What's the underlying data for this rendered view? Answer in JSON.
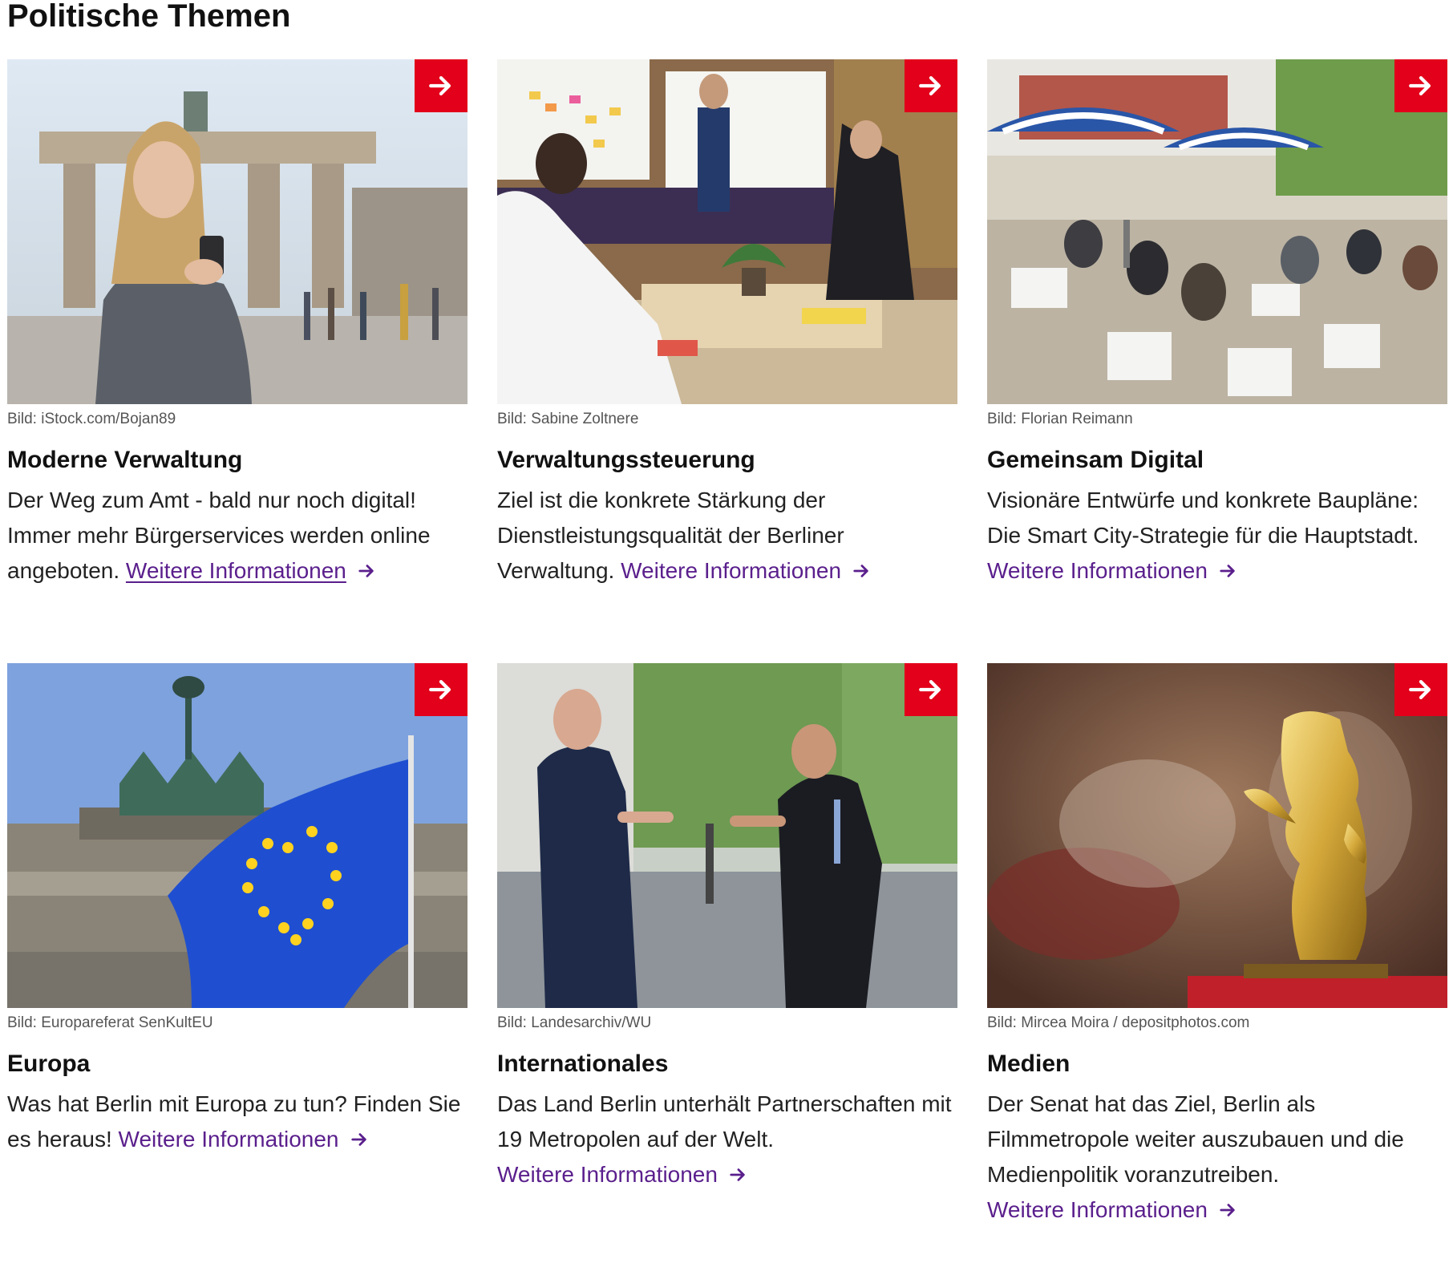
{
  "section": {
    "title": "Politische Themen"
  },
  "colors": {
    "accent_red": "#e2001a",
    "link_purple": "#5a1f8c",
    "caption_gray": "#555555"
  },
  "cards": [
    {
      "caption": "Bild: iStock.com/Bojan89",
      "title": "Moderne Verwaltung",
      "text": "Der Weg zum Amt - bald nur noch digital! Immer mehr Bürgerservices werden online angeboten. ",
      "link_label": "Weitere Informationen",
      "image_subject": "woman with smartphone at Brandenburg Gate"
    },
    {
      "caption": "Bild: Sabine Zoltnere",
      "title": "Verwaltungssteuerung",
      "text": "Ziel ist die konkrete Stärkung der Dienstleistungsqualität der Berliner Verwaltung. ",
      "link_label": "Weitere Informationen",
      "image_subject": "workshop meeting with whiteboards"
    },
    {
      "caption": "Bild: Florian Reimann",
      "title": "Gemeinsam Digital",
      "text": "Visionäre Entwürfe und konkrete Baupläne: Die Smart City-Strategie für die Hauptstadt. ",
      "link_label": "Weitere Informationen",
      "image_subject": "outdoor public participation event under parasols"
    },
    {
      "caption": "Bild: Europareferat SenKultEU",
      "title": "Europa",
      "text": "Was hat Berlin mit Europa zu tun? Finden Sie es heraus! ",
      "link_label": "Weitere Informationen",
      "image_subject": "EU flag in front of Brandenburg Gate quadriga"
    },
    {
      "caption": "Bild: Landesarchiv/WU",
      "title": "Internationales",
      "text": "Das Land Berlin unterhält Partnerschaften mit 19 Metropolen auf der Welt. ",
      "link_label": "Weitere Informationen",
      "image_subject": "two men shaking hands on a street"
    },
    {
      "caption": "Bild: Mircea Moira / depositphotos.com",
      "title": "Medien",
      "text": "Der Senat hat das Ziel, Berlin als Filmmetropole weiter auszubauen und die Medienpolitik voranzutreiben. ",
      "link_label": "Weitere Informationen",
      "image_subject": "golden Berlinale bear statuette"
    }
  ],
  "icons": {
    "corner": "arrow-right-icon",
    "link": "arrow-right-icon"
  }
}
